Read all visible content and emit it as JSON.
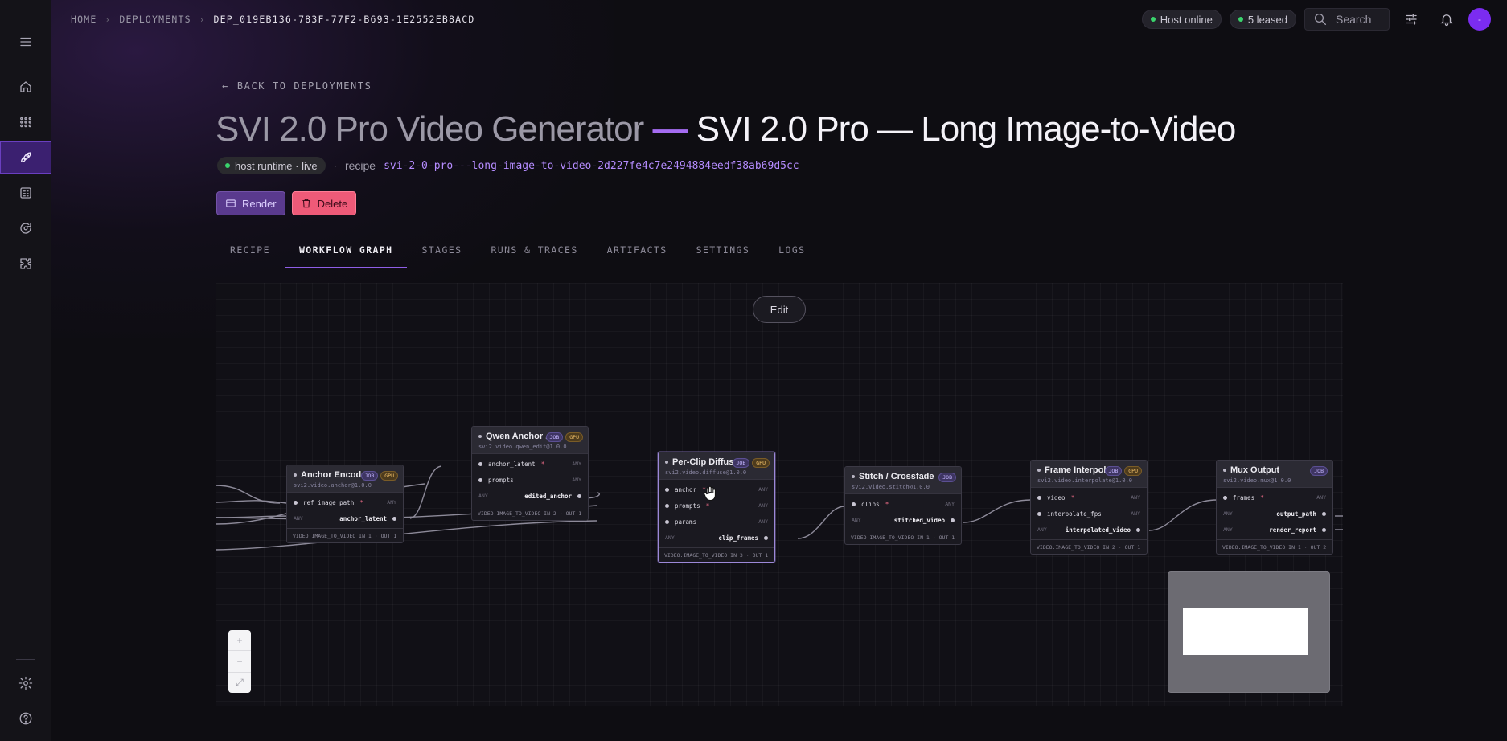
{
  "breadcrumb": {
    "home": "HOME",
    "deployments": "DEPLOYMENTS",
    "current": "DEP_019EB136-783F-77F2-B693-1E2552EB8ACD"
  },
  "topbar": {
    "host_status": "Host online",
    "leased": "5 leased",
    "search_placeholder": "Search",
    "avatar_initial": "-"
  },
  "sidebar": {
    "items": [
      "menu",
      "home",
      "apps",
      "deployments",
      "reports",
      "sync",
      "plugins",
      "settings",
      "help"
    ],
    "active": "deployments"
  },
  "back_label": "BACK TO DEPLOYMENTS",
  "title": {
    "prefix": "SVI 2.0 Pro Video Generator",
    "dash": "—",
    "main": "SVI 2.0 Pro — Long Image-to-Video"
  },
  "meta": {
    "status": "host runtime · live",
    "bullet": "·",
    "recipe_label": "recipe",
    "recipe_value": "svi-2-0-pro---long-image-to-video-2d227fe4c7e2494884eedf38ab69d5cc"
  },
  "actions": {
    "render": "Render",
    "delete": "Delete"
  },
  "tabs": [
    "RECIPE",
    "WORKFLOW GRAPH",
    "STAGES",
    "RUNS & TRACES",
    "ARTIFACTS",
    "SETTINGS",
    "LOGS"
  ],
  "active_tab": "WORKFLOW GRAPH",
  "graph": {
    "edit_label": "Edit",
    "any": "ANY",
    "req": "*",
    "badges": {
      "job": "JOB",
      "gpu": "GPU"
    },
    "nodes": [
      {
        "title": "Anchor Encode",
        "id": "svi2.video.anchor@1.0.0",
        "gpu": true,
        "inputs": [
          {
            "name": "ref_image_path",
            "required": true
          }
        ],
        "outputs": [
          "anchor_latent"
        ],
        "footer": "VIDEO.IMAGE_TO_VIDEO  IN 1 · OUT 1"
      },
      {
        "title": "Qwen Anchor ...",
        "id": "svi2.video.qwen_edit@1.0.0",
        "gpu": true,
        "inputs": [
          {
            "name": "anchor_latent",
            "required": true
          },
          {
            "name": "prompts",
            "required": false
          }
        ],
        "outputs": [
          "edited_anchor"
        ],
        "footer": "VIDEO.IMAGE_TO_VIDEO  IN 2 · OUT 1"
      },
      {
        "title": "Per-Clip Diffus...",
        "id": "svi2.video.diffuse@1.0.0",
        "gpu": true,
        "inputs": [
          {
            "name": "anchor",
            "required": true
          },
          {
            "name": "prompts",
            "required": true
          },
          {
            "name": "params",
            "required": false
          }
        ],
        "outputs": [
          "clip_frames"
        ],
        "footer": "VIDEO.IMAGE_TO_VIDEO  IN 3 · OUT 1"
      },
      {
        "title": "Stitch / Crossfade",
        "id": "svi2.video.stitch@1.0.0",
        "gpu": false,
        "inputs": [
          {
            "name": "clips",
            "required": true
          }
        ],
        "outputs": [
          "stitched_video"
        ],
        "footer": "VIDEO.IMAGE_TO_VIDEO  IN 1 · OUT 1"
      },
      {
        "title": "Frame Interpol...",
        "id": "svi2.video.interpolate@1.0.0",
        "gpu": true,
        "inputs": [
          {
            "name": "video",
            "required": true
          },
          {
            "name": "interpolate_fps",
            "required": false
          }
        ],
        "outputs": [
          "interpolated_video"
        ],
        "footer": "VIDEO.IMAGE_TO_VIDEO  IN 2 · OUT 1"
      },
      {
        "title": "Mux Output",
        "id": "svi2.video.mux@1.0.0",
        "gpu": false,
        "inputs": [
          {
            "name": "frames",
            "required": true
          }
        ],
        "outputs": [
          "output_path",
          "render_report"
        ],
        "footer": "VIDEO.IMAGE_TO_VIDEO  IN 1 · OUT 2"
      }
    ]
  },
  "colors": {
    "accent": "#8f5ee6",
    "recipe": "#b58cff",
    "delete": "#ee5a78",
    "render": "#5a3a8e",
    "online": "#3ad36c",
    "avatar": "#7b2cf0"
  }
}
